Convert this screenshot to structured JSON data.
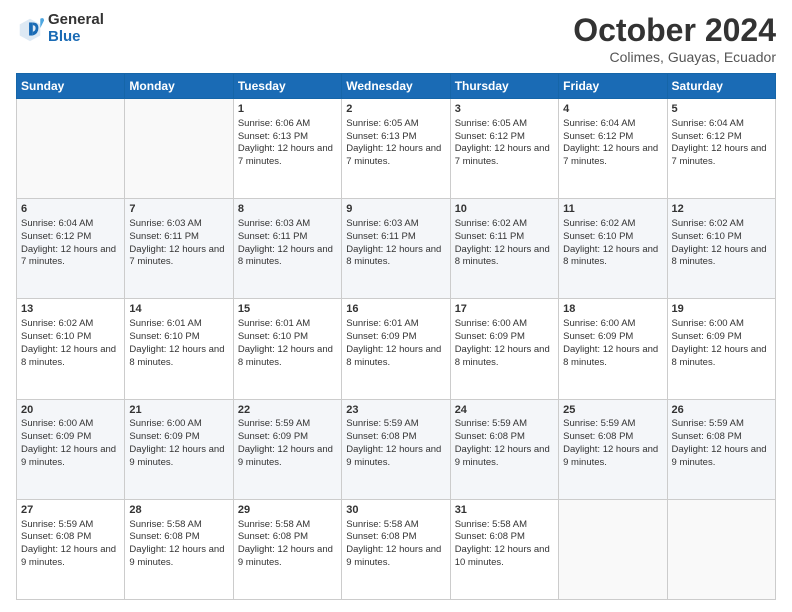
{
  "logo": {
    "general": "General",
    "blue": "Blue"
  },
  "title": "October 2024",
  "subtitle": "Colimes, Guayas, Ecuador",
  "days_of_week": [
    "Sunday",
    "Monday",
    "Tuesday",
    "Wednesday",
    "Thursday",
    "Friday",
    "Saturday"
  ],
  "weeks": [
    [
      {
        "num": "",
        "info": ""
      },
      {
        "num": "",
        "info": ""
      },
      {
        "num": "1",
        "info": "Sunrise: 6:06 AM\nSunset: 6:13 PM\nDaylight: 12 hours and 7 minutes."
      },
      {
        "num": "2",
        "info": "Sunrise: 6:05 AM\nSunset: 6:13 PM\nDaylight: 12 hours and 7 minutes."
      },
      {
        "num": "3",
        "info": "Sunrise: 6:05 AM\nSunset: 6:12 PM\nDaylight: 12 hours and 7 minutes."
      },
      {
        "num": "4",
        "info": "Sunrise: 6:04 AM\nSunset: 6:12 PM\nDaylight: 12 hours and 7 minutes."
      },
      {
        "num": "5",
        "info": "Sunrise: 6:04 AM\nSunset: 6:12 PM\nDaylight: 12 hours and 7 minutes."
      }
    ],
    [
      {
        "num": "6",
        "info": "Sunrise: 6:04 AM\nSunset: 6:12 PM\nDaylight: 12 hours and 7 minutes."
      },
      {
        "num": "7",
        "info": "Sunrise: 6:03 AM\nSunset: 6:11 PM\nDaylight: 12 hours and 7 minutes."
      },
      {
        "num": "8",
        "info": "Sunrise: 6:03 AM\nSunset: 6:11 PM\nDaylight: 12 hours and 8 minutes."
      },
      {
        "num": "9",
        "info": "Sunrise: 6:03 AM\nSunset: 6:11 PM\nDaylight: 12 hours and 8 minutes."
      },
      {
        "num": "10",
        "info": "Sunrise: 6:02 AM\nSunset: 6:11 PM\nDaylight: 12 hours and 8 minutes."
      },
      {
        "num": "11",
        "info": "Sunrise: 6:02 AM\nSunset: 6:10 PM\nDaylight: 12 hours and 8 minutes."
      },
      {
        "num": "12",
        "info": "Sunrise: 6:02 AM\nSunset: 6:10 PM\nDaylight: 12 hours and 8 minutes."
      }
    ],
    [
      {
        "num": "13",
        "info": "Sunrise: 6:02 AM\nSunset: 6:10 PM\nDaylight: 12 hours and 8 minutes."
      },
      {
        "num": "14",
        "info": "Sunrise: 6:01 AM\nSunset: 6:10 PM\nDaylight: 12 hours and 8 minutes."
      },
      {
        "num": "15",
        "info": "Sunrise: 6:01 AM\nSunset: 6:10 PM\nDaylight: 12 hours and 8 minutes."
      },
      {
        "num": "16",
        "info": "Sunrise: 6:01 AM\nSunset: 6:09 PM\nDaylight: 12 hours and 8 minutes."
      },
      {
        "num": "17",
        "info": "Sunrise: 6:00 AM\nSunset: 6:09 PM\nDaylight: 12 hours and 8 minutes."
      },
      {
        "num": "18",
        "info": "Sunrise: 6:00 AM\nSunset: 6:09 PM\nDaylight: 12 hours and 8 minutes."
      },
      {
        "num": "19",
        "info": "Sunrise: 6:00 AM\nSunset: 6:09 PM\nDaylight: 12 hours and 8 minutes."
      }
    ],
    [
      {
        "num": "20",
        "info": "Sunrise: 6:00 AM\nSunset: 6:09 PM\nDaylight: 12 hours and 9 minutes."
      },
      {
        "num": "21",
        "info": "Sunrise: 6:00 AM\nSunset: 6:09 PM\nDaylight: 12 hours and 9 minutes."
      },
      {
        "num": "22",
        "info": "Sunrise: 5:59 AM\nSunset: 6:09 PM\nDaylight: 12 hours and 9 minutes."
      },
      {
        "num": "23",
        "info": "Sunrise: 5:59 AM\nSunset: 6:08 PM\nDaylight: 12 hours and 9 minutes."
      },
      {
        "num": "24",
        "info": "Sunrise: 5:59 AM\nSunset: 6:08 PM\nDaylight: 12 hours and 9 minutes."
      },
      {
        "num": "25",
        "info": "Sunrise: 5:59 AM\nSunset: 6:08 PM\nDaylight: 12 hours and 9 minutes."
      },
      {
        "num": "26",
        "info": "Sunrise: 5:59 AM\nSunset: 6:08 PM\nDaylight: 12 hours and 9 minutes."
      }
    ],
    [
      {
        "num": "27",
        "info": "Sunrise: 5:59 AM\nSunset: 6:08 PM\nDaylight: 12 hours and 9 minutes."
      },
      {
        "num": "28",
        "info": "Sunrise: 5:58 AM\nSunset: 6:08 PM\nDaylight: 12 hours and 9 minutes."
      },
      {
        "num": "29",
        "info": "Sunrise: 5:58 AM\nSunset: 6:08 PM\nDaylight: 12 hours and 9 minutes."
      },
      {
        "num": "30",
        "info": "Sunrise: 5:58 AM\nSunset: 6:08 PM\nDaylight: 12 hours and 9 minutes."
      },
      {
        "num": "31",
        "info": "Sunrise: 5:58 AM\nSunset: 6:08 PM\nDaylight: 12 hours and 10 minutes."
      },
      {
        "num": "",
        "info": ""
      },
      {
        "num": "",
        "info": ""
      }
    ]
  ]
}
